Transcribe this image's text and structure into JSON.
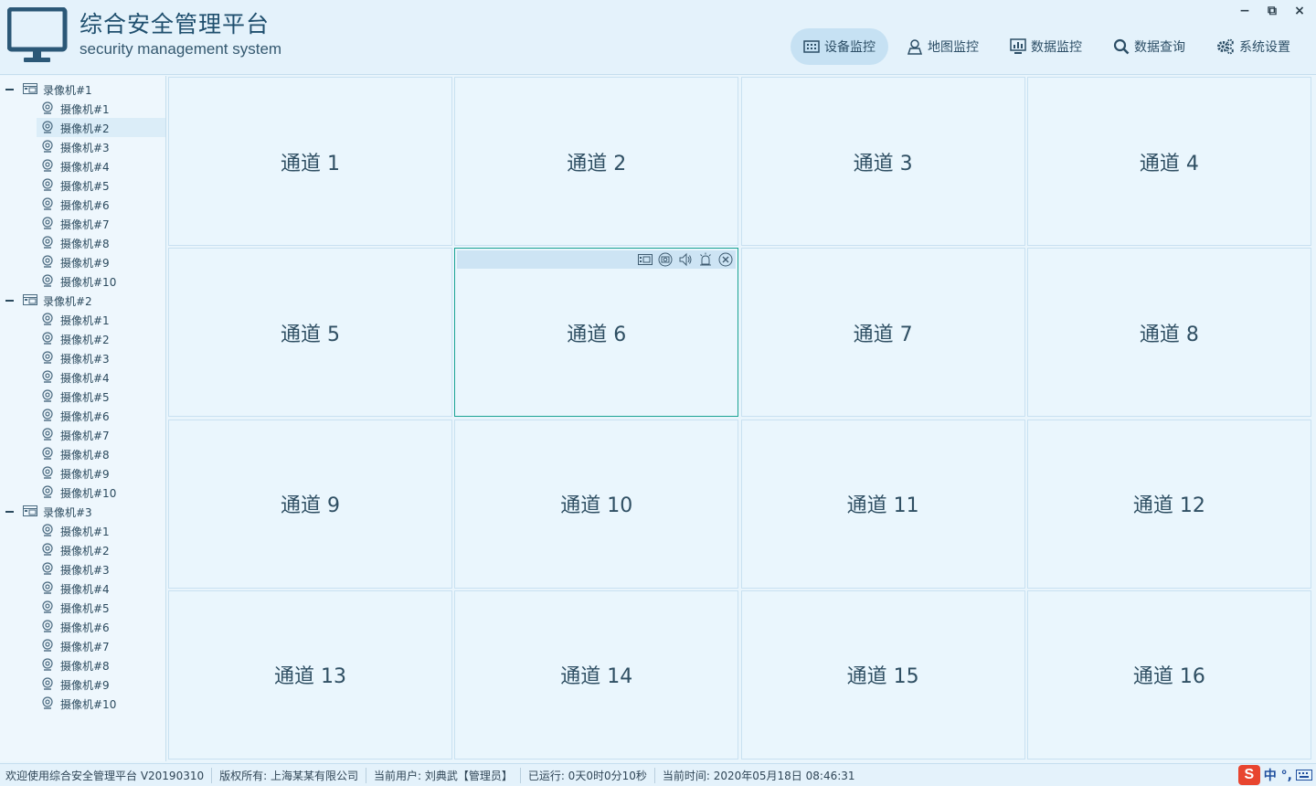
{
  "app": {
    "title": "综合安全管理平台",
    "subtitle": "security management system"
  },
  "nav": [
    {
      "label": "设备监控",
      "icon": "device-grid-icon",
      "active": true
    },
    {
      "label": "地图监控",
      "icon": "map-person-icon",
      "active": false
    },
    {
      "label": "数据监控",
      "icon": "monitor-chart-icon",
      "active": false
    },
    {
      "label": "数据查询",
      "icon": "search-icon",
      "active": false
    },
    {
      "label": "系统设置",
      "icon": "gears-icon",
      "active": false
    }
  ],
  "window_controls": {
    "minimize": "−",
    "restore": "⧉",
    "close": "×"
  },
  "tree": [
    {
      "label": "录像机#1",
      "cameras": [
        "摄像机#1",
        "摄像机#2",
        "摄像机#3",
        "摄像机#4",
        "摄像机#5",
        "摄像机#6",
        "摄像机#7",
        "摄像机#8",
        "摄像机#9",
        "摄像机#10"
      ]
    },
    {
      "label": "录像机#2",
      "cameras": [
        "摄像机#1",
        "摄像机#2",
        "摄像机#3",
        "摄像机#4",
        "摄像机#5",
        "摄像机#6",
        "摄像机#7",
        "摄像机#8",
        "摄像机#9",
        "摄像机#10"
      ]
    },
    {
      "label": "录像机#3",
      "cameras": [
        "摄像机#1",
        "摄像机#2",
        "摄像机#3",
        "摄像机#4",
        "摄像机#5",
        "摄像机#6",
        "摄像机#7",
        "摄像机#8",
        "摄像机#9",
        "摄像机#10"
      ]
    }
  ],
  "selected_camera": {
    "recorder": 0,
    "camera": 1
  },
  "channels": [
    "通道 1",
    "通道 2",
    "通道 3",
    "通道 4",
    "通道 5",
    "通道 6",
    "通道 7",
    "通道 8",
    "通道 9",
    "通道 10",
    "通道 11",
    "通道 12",
    "通道 13",
    "通道 14",
    "通道 15",
    "通道 16"
  ],
  "active_channel": 5,
  "channel_toolbar_icons": [
    "record-icon",
    "snapshot-icon",
    "audio-icon",
    "alarm-icon",
    "close-circle-icon"
  ],
  "status": {
    "welcome": "欢迎使用综合安全管理平台 V20190310",
    "copyright": "版权所有: 上海某某有限公司",
    "user": "当前用户: 刘典武【管理员】",
    "uptime": "已运行: 0天0时0分10秒",
    "time": "当前时间: 2020年05月18日 08:46:31"
  },
  "ime": {
    "logo": "S",
    "text": "中 °,"
  },
  "colors": {
    "accent": "#1aa394",
    "active_nav": "#c6e1f3",
    "background": "#e9f5fc"
  }
}
